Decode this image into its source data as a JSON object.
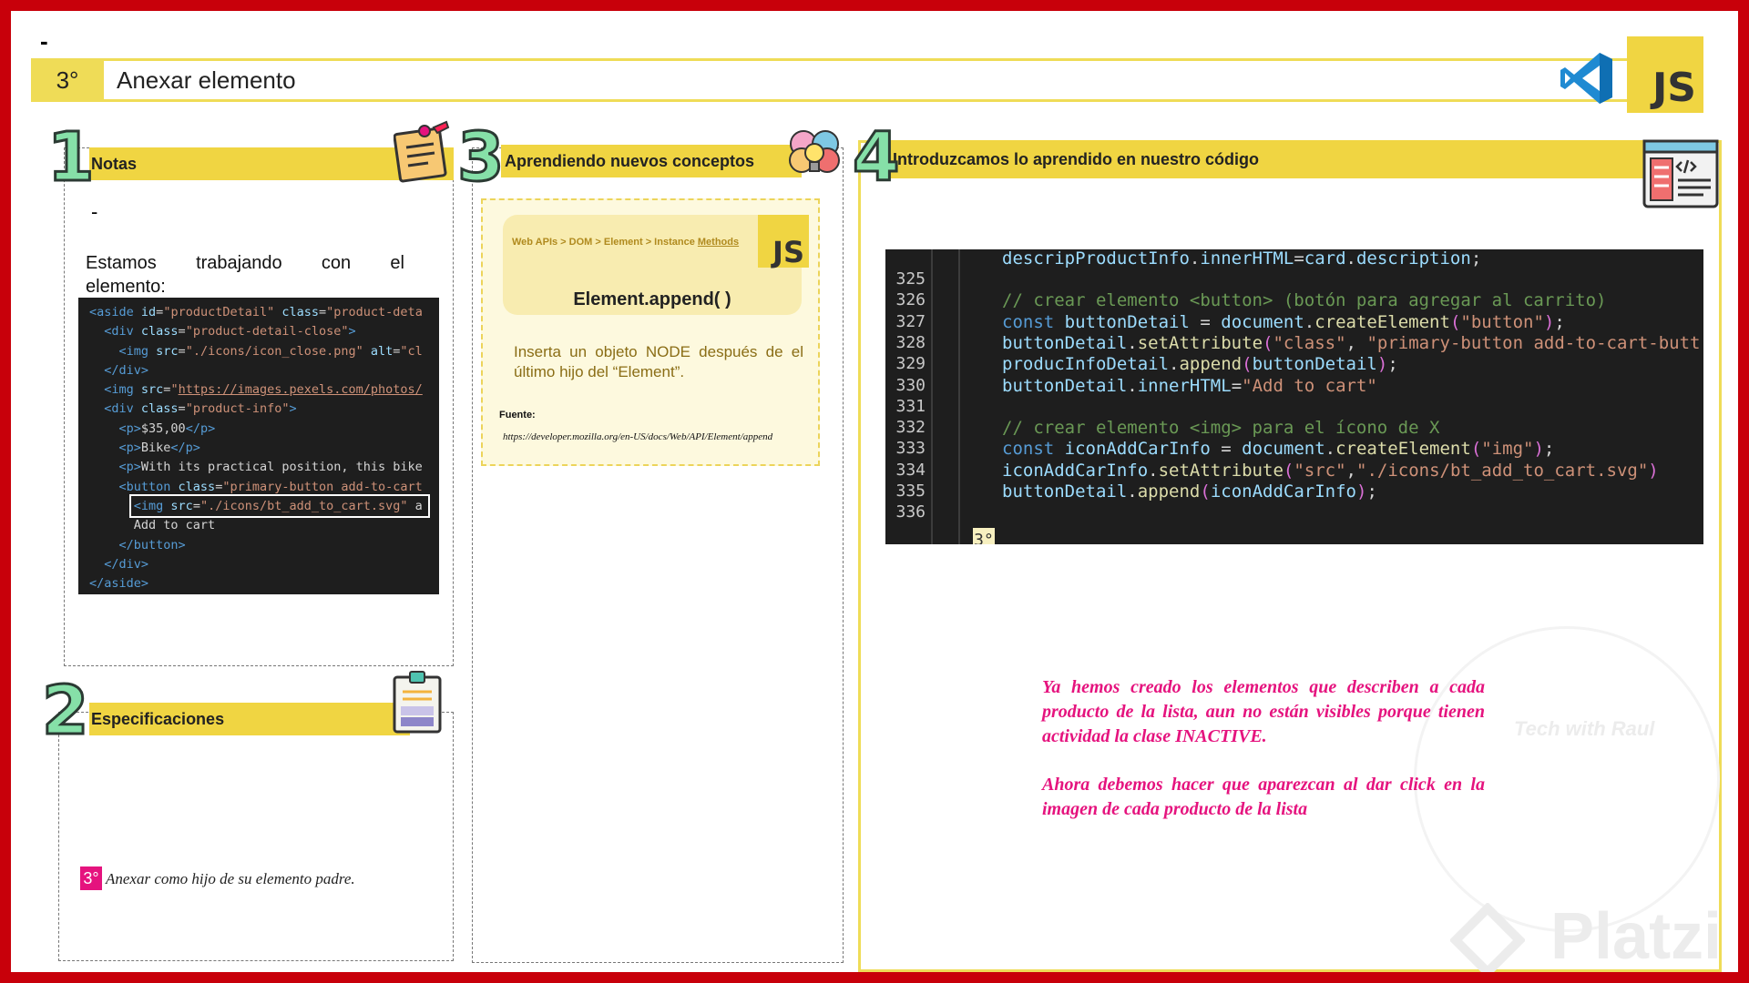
{
  "header": {
    "top_dash": "-",
    "step": "3°",
    "title": "Anexar elemento",
    "js_badge": "JS"
  },
  "section1": {
    "number": "1",
    "label": "Notas",
    "dash": "-",
    "text_line1": [
      "Estamos",
      "trabajando",
      "con",
      "el"
    ],
    "text_line2": "elemento:",
    "code_lines": [
      [
        {
          "c": "tag",
          "t": "<aside "
        },
        {
          "c": "attr",
          "t": "id"
        },
        {
          "c": "txt",
          "t": "="
        },
        {
          "c": "str",
          "t": "\"productDetail\""
        },
        {
          "c": "attr",
          "t": " class"
        },
        {
          "c": "txt",
          "t": "="
        },
        {
          "c": "str",
          "t": "\"product-deta"
        }
      ],
      [
        {
          "c": "txt",
          "t": "  "
        },
        {
          "c": "tag",
          "t": "<div "
        },
        {
          "c": "attr",
          "t": "class"
        },
        {
          "c": "txt",
          "t": "="
        },
        {
          "c": "str",
          "t": "\"product-detail-close\""
        },
        {
          "c": "tag",
          "t": ">"
        }
      ],
      [
        {
          "c": "txt",
          "t": "    "
        },
        {
          "c": "tag",
          "t": "<img "
        },
        {
          "c": "attr",
          "t": "src"
        },
        {
          "c": "txt",
          "t": "="
        },
        {
          "c": "str",
          "t": "\"./icons/icon_close.png\""
        },
        {
          "c": "attr",
          "t": " alt"
        },
        {
          "c": "txt",
          "t": "="
        },
        {
          "c": "str",
          "t": "\"cl"
        }
      ],
      [
        {
          "c": "txt",
          "t": "  "
        },
        {
          "c": "tag",
          "t": "</div>"
        }
      ],
      [
        {
          "c": "txt",
          "t": "  "
        },
        {
          "c": "tag",
          "t": "<img "
        },
        {
          "c": "attr",
          "t": "src"
        },
        {
          "c": "txt",
          "t": "="
        },
        {
          "c": "str",
          "t": "\""
        },
        {
          "c": "url",
          "t": "https://images.pexels.com/photos/"
        }
      ],
      [
        {
          "c": "txt",
          "t": "  "
        },
        {
          "c": "tag",
          "t": "<div "
        },
        {
          "c": "attr",
          "t": "class"
        },
        {
          "c": "txt",
          "t": "="
        },
        {
          "c": "str",
          "t": "\"product-info\""
        },
        {
          "c": "tag",
          "t": ">"
        }
      ],
      [
        {
          "c": "txt",
          "t": "    "
        },
        {
          "c": "tag",
          "t": "<p>"
        },
        {
          "c": "txt",
          "t": "$35,00"
        },
        {
          "c": "tag",
          "t": "</p>"
        }
      ],
      [
        {
          "c": "txt",
          "t": "    "
        },
        {
          "c": "tag",
          "t": "<p>"
        },
        {
          "c": "txt",
          "t": "Bike"
        },
        {
          "c": "tag",
          "t": "</p>"
        }
      ],
      [
        {
          "c": "txt",
          "t": "    "
        },
        {
          "c": "tag",
          "t": "<p>"
        },
        {
          "c": "txt",
          "t": "With its practical position, this bike"
        }
      ],
      [
        {
          "c": "txt",
          "t": "    "
        },
        {
          "c": "tag",
          "t": "<button "
        },
        {
          "c": "attr",
          "t": "class"
        },
        {
          "c": "txt",
          "t": "="
        },
        {
          "c": "str",
          "t": "\"primary-button add-to-cart"
        }
      ],
      [
        {
          "c": "txt",
          "t": "      "
        },
        {
          "c": "tag",
          "t": "<img "
        },
        {
          "c": "attr",
          "t": "src"
        },
        {
          "c": "txt",
          "t": "="
        },
        {
          "c": "str",
          "t": "\"./icons/bt_add_to_cart.svg\""
        },
        {
          "c": "txt",
          "t": " a"
        }
      ],
      [
        {
          "c": "txt",
          "t": "      Add to cart"
        }
      ],
      [
        {
          "c": "txt",
          "t": "    "
        },
        {
          "c": "tag",
          "t": "</button>"
        }
      ],
      [
        {
          "c": "txt",
          "t": "  "
        },
        {
          "c": "tag",
          "t": "</div>"
        }
      ],
      [
        {
          "c": "tag",
          "t": "</aside>"
        }
      ]
    ]
  },
  "section2": {
    "number": "2",
    "label": "Especificaciones",
    "badge": "3°",
    "annex_text": "Anexar como hijo de su elemento padre."
  },
  "section3": {
    "number": "3",
    "label": "Aprendiendo nuevos conceptos",
    "crumb_prefix": "Web APIs > DOM > Element > Instance ",
    "crumb_link": "Methods",
    "js_badge": "JS",
    "method": "Element.append( )",
    "description": "Inserta un objeto NODE después de el último hijo del “Element”.",
    "fuente_label": "Fuente:",
    "fuente_url": "https://developer.mozilla.org/en-US/docs/Web/API/Element/append"
  },
  "section4": {
    "number": "4",
    "label": "Introduzcamos lo aprendido en nuestro código",
    "partial_top": [
      {
        "c": "var",
        "t": "descripProductInfo"
      },
      {
        "c": "op",
        "t": "."
      },
      {
        "c": "var",
        "t": "innerHTML"
      },
      {
        "c": "op",
        "t": "="
      },
      {
        "c": "var",
        "t": "card"
      },
      {
        "c": "op",
        "t": "."
      },
      {
        "c": "var",
        "t": "description"
      },
      {
        "c": "op",
        "t": ";"
      }
    ],
    "lines": [
      {
        "n": "325",
        "code": []
      },
      {
        "n": "326",
        "code": [
          {
            "c": "cmt",
            "t": "// crear elemento <button> (botón para agregar al carrito)"
          }
        ]
      },
      {
        "n": "327",
        "code": [
          {
            "c": "kw",
            "t": "const "
          },
          {
            "c": "var",
            "t": "buttonDetail"
          },
          {
            "c": "op",
            "t": " = "
          },
          {
            "c": "var",
            "t": "document"
          },
          {
            "c": "op",
            "t": "."
          },
          {
            "c": "fn",
            "t": "createElement"
          },
          {
            "c": "br",
            "t": "("
          },
          {
            "c": "s",
            "t": "\"button\""
          },
          {
            "c": "br",
            "t": ")"
          },
          {
            "c": "op",
            "t": ";"
          }
        ]
      },
      {
        "n": "328",
        "code": [
          {
            "c": "var",
            "t": "buttonDetail"
          },
          {
            "c": "op",
            "t": "."
          },
          {
            "c": "fn",
            "t": "setAttribute"
          },
          {
            "c": "br",
            "t": "("
          },
          {
            "c": "s",
            "t": "\"class\""
          },
          {
            "c": "op",
            "t": ", "
          },
          {
            "c": "s",
            "t": "\"primary-button add-to-cart-butt"
          }
        ]
      },
      {
        "n": "329",
        "code": [
          {
            "c": "var",
            "t": "producInfoDetail"
          },
          {
            "c": "op",
            "t": "."
          },
          {
            "c": "fn",
            "t": "append"
          },
          {
            "c": "br",
            "t": "("
          },
          {
            "c": "var",
            "t": "buttonDetail"
          },
          {
            "c": "br",
            "t": ")"
          },
          {
            "c": "op",
            "t": ";"
          }
        ]
      },
      {
        "n": "330",
        "code": [
          {
            "c": "var",
            "t": "buttonDetail"
          },
          {
            "c": "op",
            "t": "."
          },
          {
            "c": "var",
            "t": "innerHTML"
          },
          {
            "c": "op",
            "t": "="
          },
          {
            "c": "s",
            "t": "\"Add to cart\""
          }
        ]
      },
      {
        "n": "331",
        "code": []
      },
      {
        "n": "332",
        "code": [
          {
            "c": "cmt",
            "t": "// crear elemento <img> para el ícono de X"
          }
        ]
      },
      {
        "n": "333",
        "code": [
          {
            "c": "kw",
            "t": "const "
          },
          {
            "c": "var",
            "t": "iconAddCarInfo"
          },
          {
            "c": "op",
            "t": " = "
          },
          {
            "c": "var",
            "t": "document"
          },
          {
            "c": "op",
            "t": "."
          },
          {
            "c": "fn",
            "t": "createElement"
          },
          {
            "c": "br",
            "t": "("
          },
          {
            "c": "s",
            "t": "\"img\""
          },
          {
            "c": "br",
            "t": ")"
          },
          {
            "c": "op",
            "t": ";"
          }
        ]
      },
      {
        "n": "334",
        "code": [
          {
            "c": "var",
            "t": "iconAddCarInfo"
          },
          {
            "c": "op",
            "t": "."
          },
          {
            "c": "fn",
            "t": "setAttribute"
          },
          {
            "c": "br",
            "t": "("
          },
          {
            "c": "s",
            "t": "\"src\""
          },
          {
            "c": "op",
            "t": ","
          },
          {
            "c": "s",
            "t": "\"./icons/bt_add_to_cart.svg\""
          },
          {
            "c": "br",
            "t": ")"
          }
        ]
      },
      {
        "n": "335",
        "code": [
          {
            "c": "var",
            "t": "buttonDetail"
          },
          {
            "c": "op",
            "t": "."
          },
          {
            "c": "fn",
            "t": "append"
          },
          {
            "c": "br",
            "t": "("
          },
          {
            "c": "var",
            "t": "iconAddCarInfo"
          },
          {
            "c": "br",
            "t": ")"
          },
          {
            "c": "op",
            "t": ";"
          }
        ]
      },
      {
        "n": "336",
        "code": []
      }
    ],
    "badge": "3°",
    "closing_brace": "}",
    "message_p1": "Ya hemos creado los elementos que describen a cada producto de la lista, aun no están visibles porque tienen actividad la clase INACTIVE.",
    "message_p2": "Ahora debemos hacer que aparezcan al dar click en la imagen de cada producto de la lista"
  },
  "watermark": {
    "text": "Tech with Raul",
    "brand": "Platzi"
  },
  "icons": [
    "vscode-icon",
    "sticky-note-icon",
    "clipboard-icon",
    "brain-icon",
    "code-window-icon",
    "platzi-logo-icon"
  ]
}
